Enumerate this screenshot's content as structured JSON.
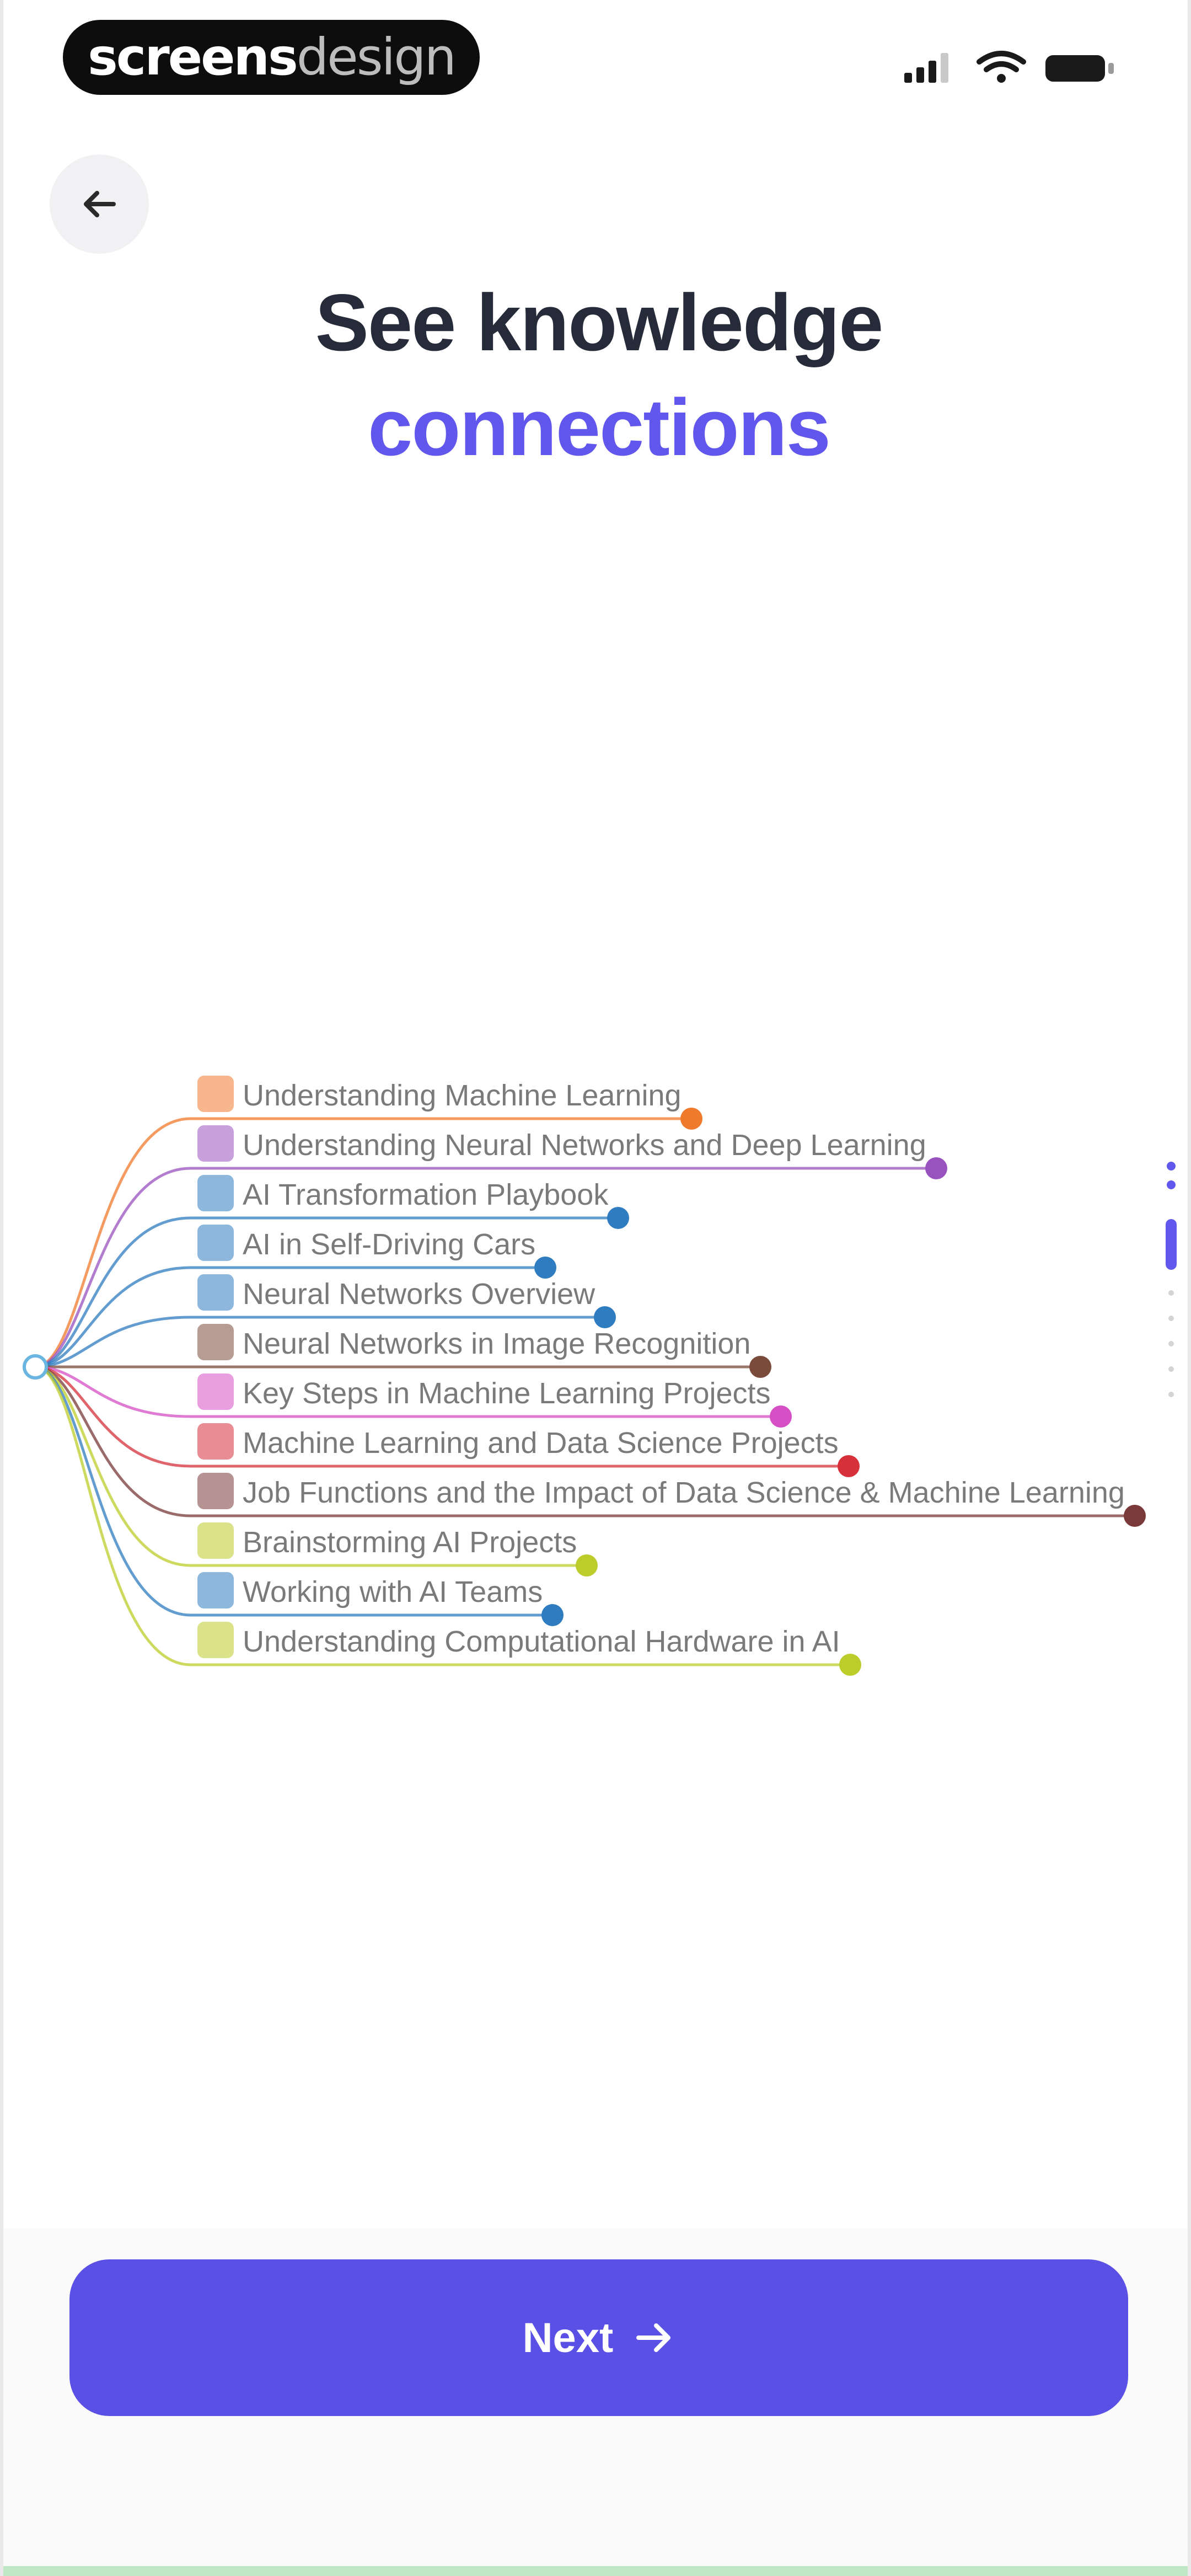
{
  "status_bar": {
    "brand_part1": "screens",
    "brand_part2": "design"
  },
  "header": {
    "back_icon": "arrow-left-icon",
    "title_line1": "See knowledge",
    "title_line2": "connections",
    "accent_color": "#6257ec"
  },
  "mind_map": {
    "items": [
      {
        "label": "Understanding Machine Learning",
        "icon": "robot-icon",
        "color": "#f07a2c"
      },
      {
        "label": "Understanding Neural Networks and Deep Learning",
        "icon": "brain-icon",
        "color": "#9a52bf"
      },
      {
        "label": "AI Transformation Playbook",
        "icon": "tools-icon",
        "color": "#2f7cc0"
      },
      {
        "label": "AI in Self-Driving Cars",
        "icon": "car-icon",
        "color": "#2f7cc0"
      },
      {
        "label": "Neural Networks Overview",
        "icon": "brain-icon",
        "color": "#2f7cc0"
      },
      {
        "label": "Neural Networks in Image Recognition",
        "icon": "picture-icon",
        "color": "#7a4a3a"
      },
      {
        "label": "Key Steps in Machine Learning Projects",
        "icon": "chart-icon",
        "color": "#d64fc4"
      },
      {
        "label": "Machine Learning and Data Science Projects",
        "icon": "car-icon",
        "color": "#d6303a"
      },
      {
        "label": "Job Functions and the Impact of Data Science & Machine Learning",
        "icon": "magnifier-icon",
        "color": "#7a3a3a"
      },
      {
        "label": "Brainstorming AI Projects",
        "icon": "robot-icon",
        "color": "#bccc2a"
      },
      {
        "label": "Working with AI Teams",
        "icon": "robot-icon",
        "color": "#2f7cc0"
      },
      {
        "label": "Understanding Computational Hardware in AI",
        "icon": "computer-icon",
        "color": "#bccc2a"
      }
    ]
  },
  "footer": {
    "next_label": "Next",
    "next_icon": "arrow-right-icon",
    "button_color": "#5b50e6"
  }
}
